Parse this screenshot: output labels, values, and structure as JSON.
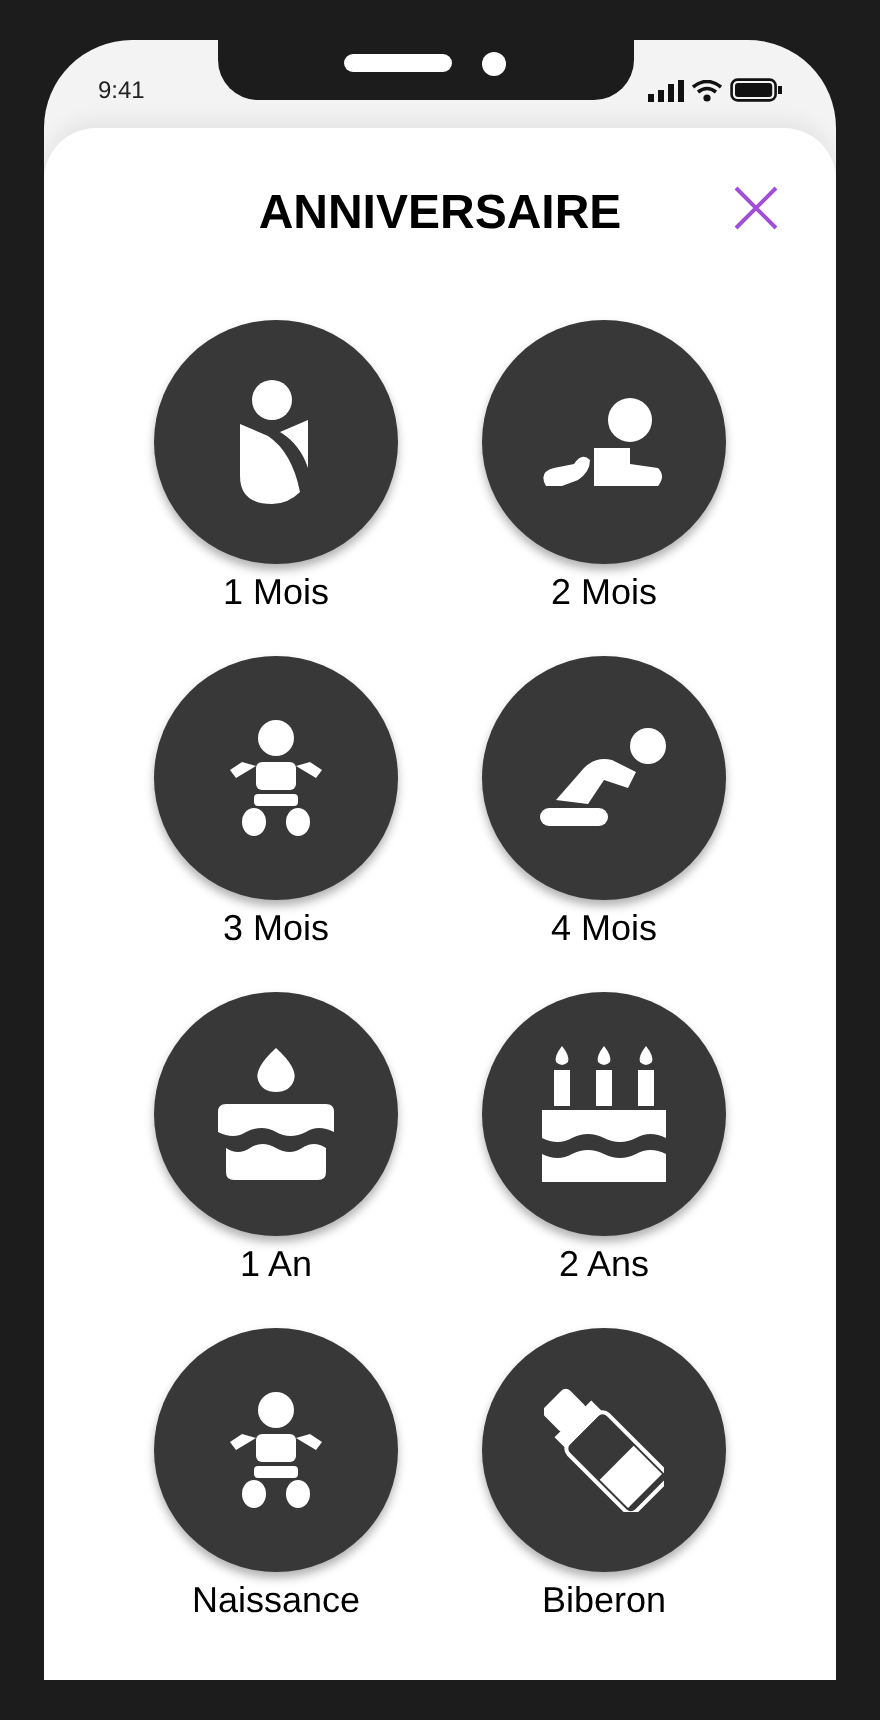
{
  "status_bar": {
    "time": "9:41"
  },
  "header": {
    "title": "ANNIVERSAIRE"
  },
  "items": [
    {
      "label": "1 Mois",
      "kind": "swaddle"
    },
    {
      "label": "2 Mois",
      "kind": "crawl"
    },
    {
      "label": "3 Mois",
      "kind": "baby"
    },
    {
      "label": "4 Mois",
      "kind": "crouch"
    },
    {
      "label": "1 An",
      "kind": "cake-one"
    },
    {
      "label": "2 Ans",
      "kind": "cake-three"
    },
    {
      "label": "Naissance",
      "kind": "baby"
    },
    {
      "label": "Biberon",
      "kind": "bottle"
    }
  ]
}
